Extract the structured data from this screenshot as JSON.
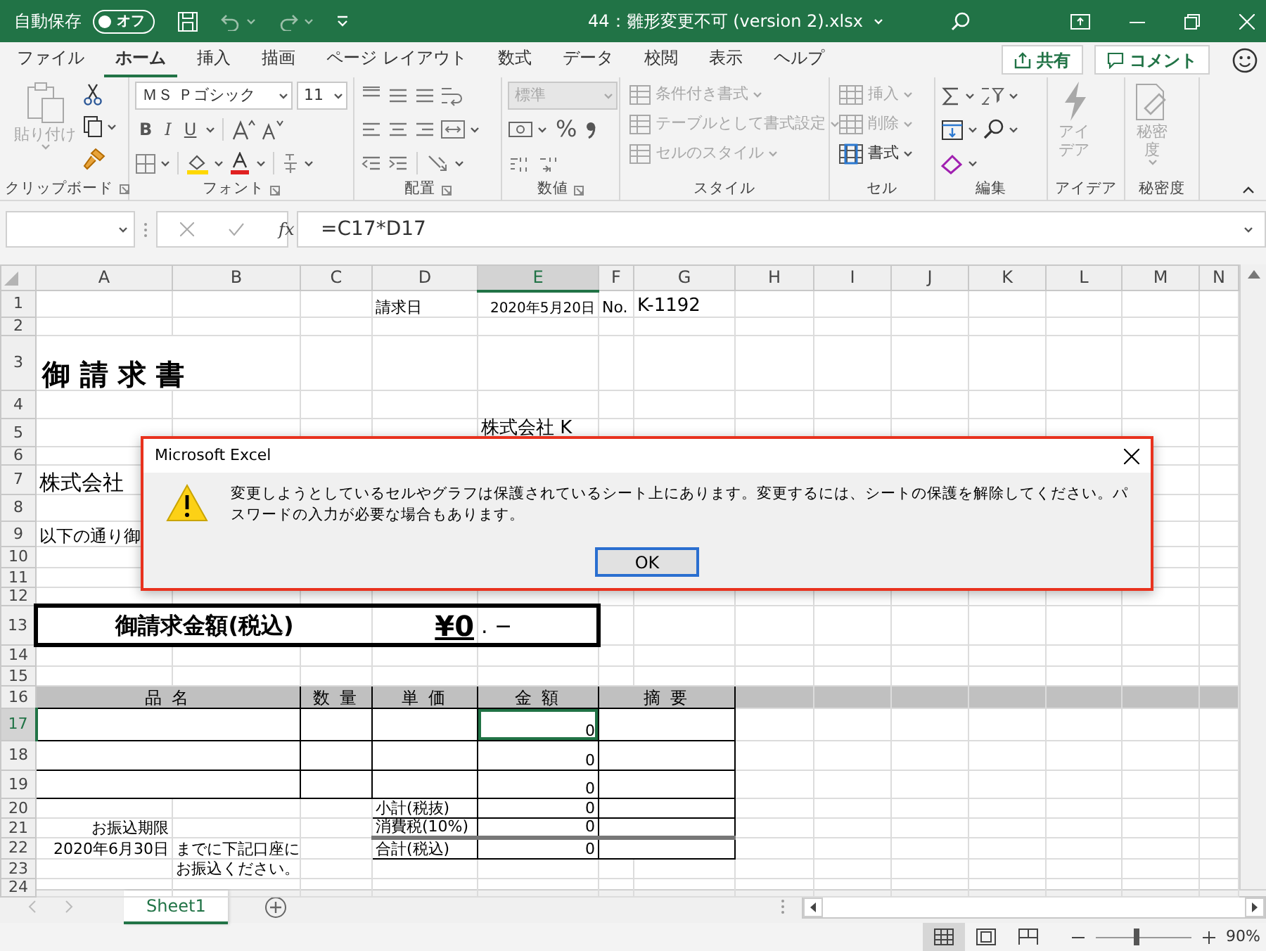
{
  "title_bar": {
    "autosave_label": "自動保存",
    "autosave": {
      "label": "オフ",
      "on": false
    },
    "document_title": "44：雛形変更不可 (version 2).xlsx"
  },
  "menu_tabs": [
    {
      "label": "ファイル",
      "selected": false
    },
    {
      "label": "ホーム",
      "selected": true
    },
    {
      "label": "挿入",
      "selected": false
    },
    {
      "label": "描画",
      "selected": false
    },
    {
      "label": "ページ レイアウト",
      "selected": false
    },
    {
      "label": "数式",
      "selected": false
    },
    {
      "label": "データ",
      "selected": false
    },
    {
      "label": "校閲",
      "selected": false
    },
    {
      "label": "表示",
      "selected": false
    },
    {
      "label": "ヘルプ",
      "selected": false
    }
  ],
  "share_button": "共有",
  "comment_button": "コメント",
  "ribbon": {
    "groups": [
      {
        "label": "クリップボード",
        "items": [
          {
            "kind": "large",
            "label": "貼り付け",
            "disabled": true
          }
        ]
      },
      {
        "label": "フォント",
        "items": [
          {
            "kind": "field",
            "value": "ＭＳ Ｐゴシック",
            "disabled": false
          },
          {
            "kind": "field",
            "value": "11",
            "disabled": false
          },
          {
            "kind": "format",
            "label": "B"
          },
          {
            "kind": "format",
            "label": "I"
          },
          {
            "kind": "format",
            "label": "U"
          }
        ]
      },
      {
        "label": "配置"
      },
      {
        "label": "数値",
        "items": [
          {
            "kind": "field",
            "value": "標準",
            "disabled": true
          },
          {
            "kind": "format",
            "label": "%"
          }
        ]
      },
      {
        "label": "スタイル",
        "items": [
          {
            "kind": "small",
            "label": "条件付き書式",
            "disabled": true
          },
          {
            "kind": "small",
            "label": "テーブルとして書式設定",
            "disabled": true
          },
          {
            "kind": "small",
            "label": "セルのスタイル",
            "disabled": true
          }
        ]
      },
      {
        "label": "セル",
        "items": [
          {
            "kind": "small",
            "label": "挿入",
            "disabled": true
          },
          {
            "kind": "small",
            "label": "削除",
            "disabled": true
          },
          {
            "kind": "small",
            "label": "書式",
            "disabled": false
          }
        ]
      },
      {
        "label": "編集"
      },
      {
        "label": "アイデア",
        "items": [
          {
            "kind": "large",
            "label": "アイデア",
            "disabled": true
          }
        ]
      },
      {
        "label": "秘密度",
        "items": [
          {
            "kind": "large",
            "label": "秘密度",
            "disabled": true
          }
        ]
      }
    ]
  },
  "formula_bar": {
    "function_label": "fx",
    "formula": "=C17*D17"
  },
  "sheet": {
    "columns": [
      {
        "label": "A",
        "selected": false
      },
      {
        "label": "B",
        "selected": false
      },
      {
        "label": "C",
        "selected": false
      },
      {
        "label": "D",
        "selected": false
      },
      {
        "label": "E",
        "selected": true
      },
      {
        "label": "F",
        "selected": false
      },
      {
        "label": "G",
        "selected": false
      },
      {
        "label": "H",
        "selected": false
      },
      {
        "label": "I",
        "selected": false
      },
      {
        "label": "J",
        "selected": false
      },
      {
        "label": "K",
        "selected": false
      },
      {
        "label": "L",
        "selected": false
      },
      {
        "label": "M",
        "selected": false
      },
      {
        "label": "N",
        "selected": false
      }
    ],
    "rows": [
      {
        "header": "1",
        "selected": false,
        "kind": "info",
        "cells": {
          "D": "請求日",
          "E": "2020年5月20日",
          "F": "No.",
          "G": "K-1192"
        }
      },
      {
        "header": "2",
        "selected": false
      },
      {
        "header": "3",
        "selected": false,
        "kind": "heading",
        "cells": {
          "A": "御 請 求 書"
        }
      },
      {
        "header": "4",
        "selected": false
      },
      {
        "header": "5",
        "selected": false,
        "kind": "company",
        "cells": {
          "E": "株式会社 K"
        }
      },
      {
        "header": "6",
        "selected": false
      },
      {
        "header": "7",
        "selected": false,
        "kind": "company",
        "cells": {
          "A": "株式会社"
        }
      },
      {
        "header": "8",
        "selected": false
      },
      {
        "header": "9",
        "selected": false,
        "cells": {
          "A": "以下の通り御"
        }
      },
      {
        "header": "10",
        "selected": false
      },
      {
        "header": "11",
        "selected": false
      },
      {
        "header": "12",
        "selected": false
      },
      {
        "header": "13",
        "selected": false,
        "kind": "total",
        "cells": {
          "A": "御請求金額(税込)",
          "D": "¥0",
          "E": ". −"
        }
      },
      {
        "header": "14",
        "selected": false
      },
      {
        "header": "15",
        "selected": false
      },
      {
        "header": "16",
        "selected": false,
        "kind": "table-head",
        "cells": {
          "A": "品名",
          "C": "数量",
          "D": "単価",
          "E": "金額",
          "F": "摘要"
        }
      },
      {
        "header": "17",
        "selected": true,
        "kind": "table-row",
        "cells": {
          "E": "0"
        }
      },
      {
        "header": "18",
        "selected": false,
        "kind": "table-row",
        "cells": {
          "E": "0"
        }
      },
      {
        "header": "19",
        "selected": false,
        "kind": "table-row",
        "cells": {
          "E": "0"
        }
      },
      {
        "header": "20",
        "selected": false,
        "kind": "summary",
        "cells": {
          "D": "小計(税抜)",
          "E": "0"
        }
      },
      {
        "header": "21",
        "selected": false,
        "kind": "summary",
        "cells": {
          "A": "お振込期限",
          "D": "消費税(10%)",
          "E": "0"
        }
      },
      {
        "header": "22",
        "selected": false,
        "kind": "summary-total",
        "cells": {
          "A": "2020年6月30日",
          "B": "までに下記口座に",
          "D": "合計(税込)",
          "E": "0"
        }
      },
      {
        "header": "23",
        "selected": false,
        "cells": {
          "B": "お振込ください。"
        }
      },
      {
        "header": "24",
        "selected": false
      }
    ]
  },
  "dialog": {
    "title": "Microsoft Excel",
    "message": "変更しようとしているセルやグラフは保護されているシート上にあります。変更するには、シートの保護を解除してください。パスワードの入力が必要な場合もあります。",
    "ok_button": "OK"
  },
  "sheet_tabs": [
    {
      "label": "Sheet1",
      "selected": true
    }
  ],
  "status_bar": {
    "views": [
      {
        "kind": "normal",
        "selected": true
      },
      {
        "kind": "page-layout",
        "selected": false
      },
      {
        "kind": "page-break",
        "selected": false
      }
    ],
    "zoom": {
      "level": 0.44,
      "reading": "90%"
    }
  }
}
